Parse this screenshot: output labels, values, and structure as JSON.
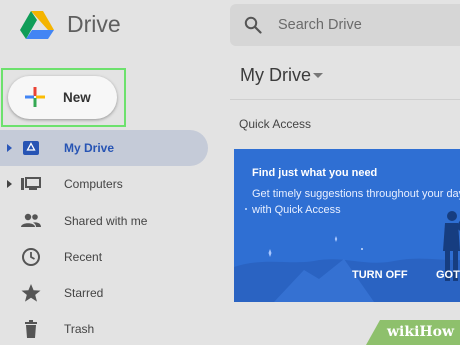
{
  "app": {
    "name": "Drive"
  },
  "search": {
    "placeholder": "Search Drive"
  },
  "new_button": {
    "label": "New"
  },
  "sidebar": {
    "items": [
      {
        "label": "My Drive",
        "icon": "drive-icon",
        "active": true,
        "expandable": true
      },
      {
        "label": "Computers",
        "icon": "computers-icon",
        "active": false,
        "expandable": true
      },
      {
        "label": "Shared with me",
        "icon": "people-icon",
        "active": false,
        "expandable": false
      },
      {
        "label": "Recent",
        "icon": "clock-icon",
        "active": false,
        "expandable": false
      },
      {
        "label": "Starred",
        "icon": "star-icon",
        "active": false,
        "expandable": false
      },
      {
        "label": "Trash",
        "icon": "trash-icon",
        "active": false,
        "expandable": false
      }
    ]
  },
  "main": {
    "breadcrumb": "My Drive",
    "quick_access_label": "Quick Access",
    "banner": {
      "heading": "Find just what you need",
      "body": "Get timely suggestions throughout your day with Quick Access",
      "turn_off_label": "TURN OFF",
      "got_it_label": "GOT"
    }
  },
  "watermark": {
    "wiki": "wiki",
    "how": "How"
  },
  "colors": {
    "accent": "#2754b4",
    "banner": "#2f6fd3",
    "highlight_frame": "#6de16d",
    "sidebar_active": "#c5cbd8",
    "watermark_bg": "#8ec06c"
  }
}
